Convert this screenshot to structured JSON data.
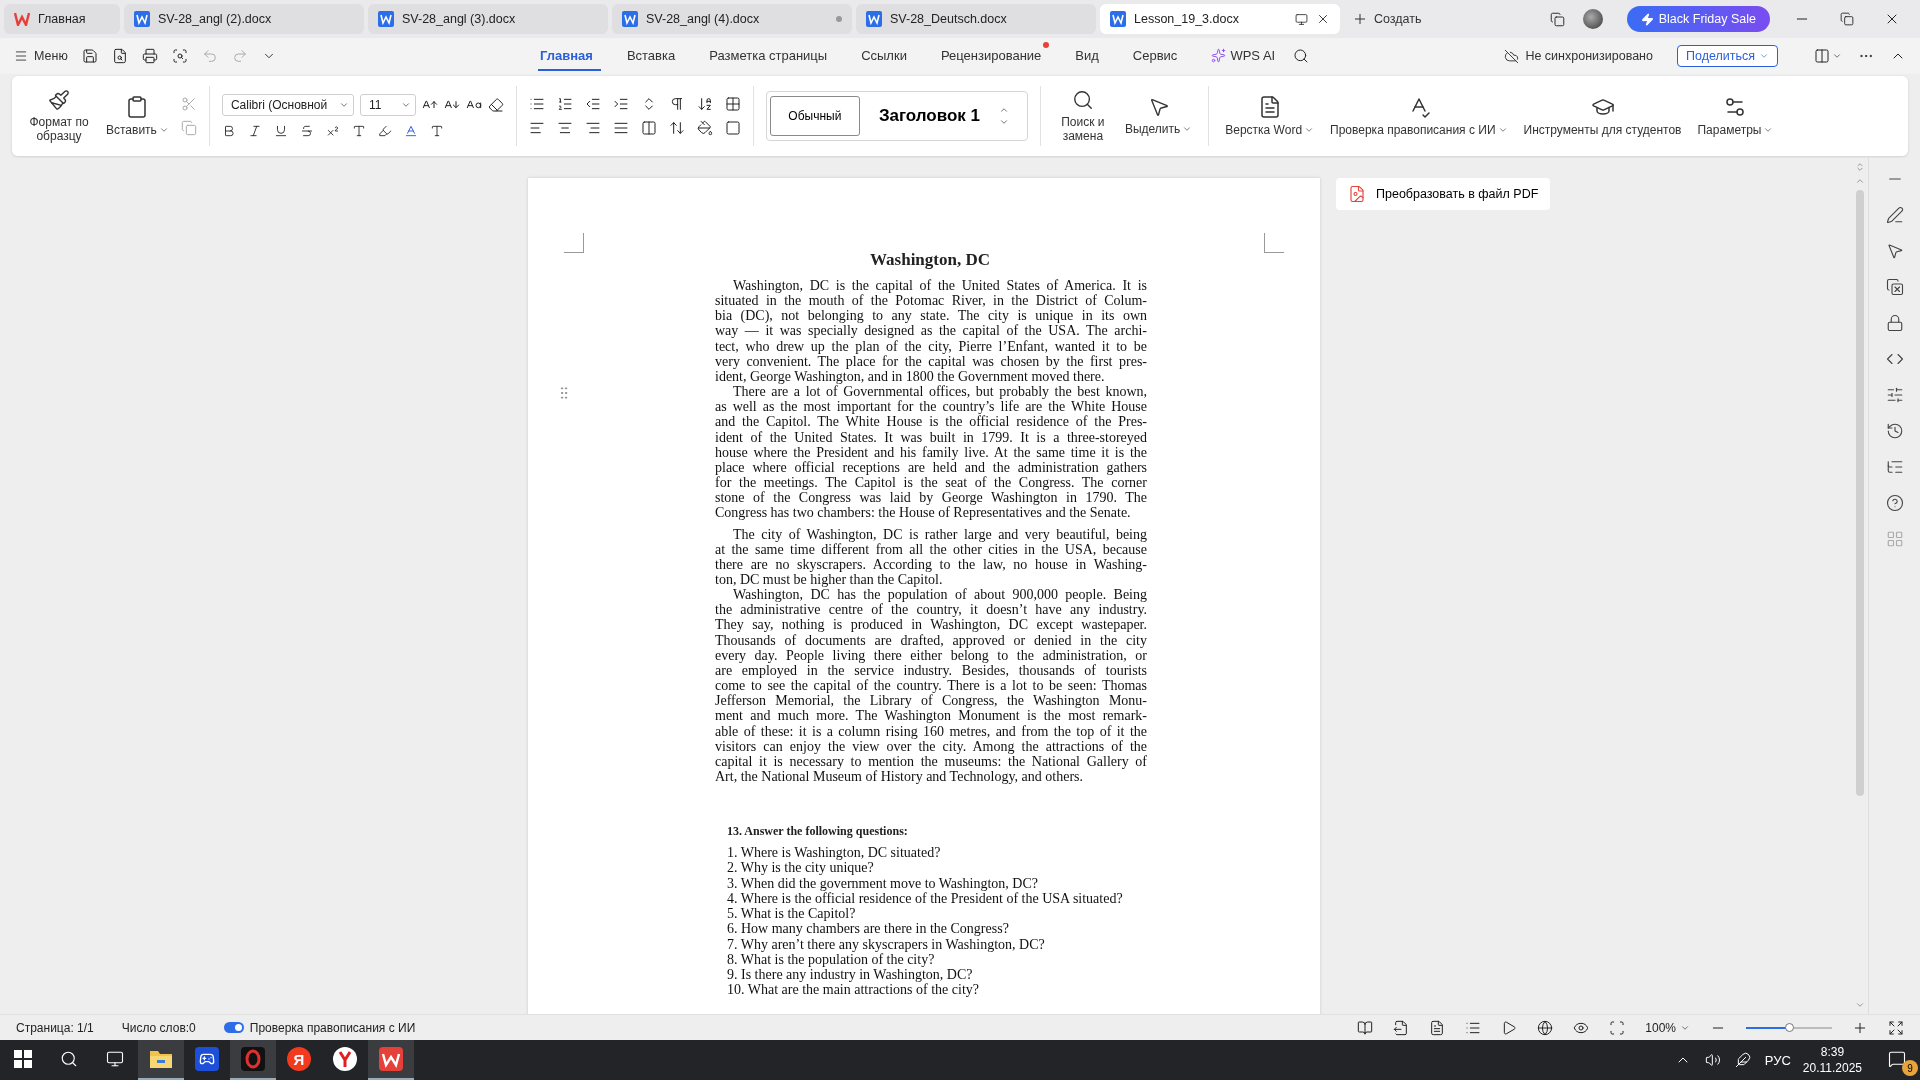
{
  "window_tabs": [
    {
      "kind": "home",
      "label": "Главная",
      "selected": false,
      "modified": false
    },
    {
      "kind": "doc",
      "label": "SV-28_angl (2).docx",
      "selected": false,
      "modified": false
    },
    {
      "kind": "doc",
      "label": "SV-28_angl (3).docx",
      "selected": false,
      "modified": false
    },
    {
      "kind": "doc",
      "label": "SV-28_angl (4).docx",
      "selected": false,
      "modified": true
    },
    {
      "kind": "doc",
      "label": "SV-28_Deutsch.docx",
      "selected": false,
      "modified": false
    },
    {
      "kind": "doc",
      "label": "Lesson_19_3.docx",
      "selected": true,
      "modified": false
    }
  ],
  "new_tab": "Создать",
  "promo_button": "Black Friday Sale",
  "menu_button": "Меню",
  "ribbon_tabs": [
    {
      "kind": "text",
      "label": "Главная",
      "selected": true,
      "notified": false
    },
    {
      "kind": "text",
      "label": "Вставка",
      "selected": false,
      "notified": false
    },
    {
      "kind": "text",
      "label": "Разметка страницы",
      "selected": false,
      "notified": false
    },
    {
      "kind": "text",
      "label": "Ссылки",
      "selected": false,
      "notified": false
    },
    {
      "kind": "text",
      "label": "Рецензирование",
      "selected": false,
      "notified": true
    },
    {
      "kind": "text",
      "label": "Вид",
      "selected": false,
      "notified": false
    },
    {
      "kind": "text",
      "label": "Сервис",
      "selected": false,
      "notified": false
    },
    {
      "kind": "ai",
      "label": "WPS AI",
      "selected": false,
      "notified": false
    }
  ],
  "sync_status": "Не синхронизировано",
  "share_button": "Поделиться",
  "ribbon": {
    "format_painter": "Формат по образцу",
    "paste": "Вставить",
    "font_name": "Calibri (Основной",
    "font_size": "11",
    "styles": [
      {
        "kind": "normal",
        "label": "Обычный",
        "selected": true
      },
      {
        "kind": "heading",
        "label": "Заголовок 1",
        "selected": false
      }
    ],
    "find_replace": "Поиск и замена",
    "select": "Выделить",
    "tools": [
      {
        "kind": "layout",
        "label": "Верстка Word",
        "dropdown": true
      },
      {
        "kind": "spell",
        "label": "Проверка правописания с ИИ",
        "dropdown": true
      },
      {
        "kind": "students",
        "label": "Инструменты для студентов",
        "dropdown": false
      },
      {
        "kind": "params",
        "label": "Параметры",
        "dropdown": true
      }
    ]
  },
  "side_panel": {
    "convert_button": "Преобразовать в файл PDF"
  },
  "document": {
    "title": "Washington, DC",
    "paragraphs": [
      {
        "lines": [
          "Washington, DC is the capital of the United States of America. It is",
          "situated in the mouth of the Potomac River, in the District of Colum-",
          "bia (DC), not belonging to any state. The city is unique in its own",
          "way — it was specially designed as the capital of the USA. The archi-",
          "tect, who drew up the plan of the city, Pierre l’Enfant, wanted it to be",
          "very convenient. The place for the capital was chosen by the first pres-",
          "ident, George Washington, and in 1800 the Government moved there."
        ]
      },
      {
        "lines": [
          "There are a lot of Governmental offices, but probably the best known,",
          "as well as the most important for the country’s life are the White House",
          "and the Capitol. The White House is the official residence of the Pres-",
          "ident of the United States. It was built in 1799. It is a three-storeyed",
          "house where the President and his family live. At the same time it is the",
          "place where official receptions are held and the administration gathers",
          "for the meetings. The Capitol is the seat of the Congress. The corner",
          "stone of the Congress was laid by George Washington in 1790. The",
          "Congress has two chambers: the House of Representatives and the Senate."
        ]
      },
      {
        "lines": [
          "The city of Washington, DC is rather large and very beautiful, being",
          "at the same time different from all the other cities in the USA, because",
          "there are no skyscrapers. According to the law, no house in Washing-",
          "ton, DC must be higher than the Capitol."
        ]
      },
      {
        "lines": [
          "Washington, DC has the population of about 900,000 people. Being",
          "the administrative centre of the country, it doesn’t have any industry.",
          "They say, nothing is produced in Washington, DC except wastepaper.",
          "Thousands of documents are drafted, approved or denied in the city",
          "every day. People living there either belong to the administration, or",
          "are employed in the service industry. Besides, thousands of tourists",
          "come to see the capital of the country. There is a lot to be seen: Thomas",
          "Jefferson Memorial, the Library of Congress, the Washington Monu-",
          "ment and much more. The Washington Monument is the most remark-",
          "able of these: it is a column rising 160 metres, and from the top of it the",
          "visitors can enjoy the view over the city. Among the attractions of the",
          "capital it is necessary to mention the museums: the National Gallery of",
          "Art, the National Museum of History and Technology, and others."
        ]
      }
    ],
    "exercise": {
      "heading": "13. Answer the following questions:",
      "questions": [
        "1. Where is Washington, DC situated?",
        "2. Why is the city unique?",
        "3. When did the government move to Washington, DC?",
        "4. Where is the official residence of the President of the USA situated?",
        "5. What is the Capitol?",
        "6. How many chambers are there in the Congress?",
        "7. Why aren’t there any skyscrapers in Washington, DC?",
        "8. What is the population of the city?",
        "9. Is there any industry in Washington, DC?",
        "10. What are the main attractions of the city?"
      ]
    }
  },
  "status_bar": {
    "page": "Страница: 1/1",
    "words": "Число слов:0",
    "spellcheck": {
      "label": "Проверка правописания с ИИ",
      "on": true
    },
    "zoom": "100%",
    "zoom_slider": {
      "level": 0.5
    }
  },
  "taskbar": {
    "apps": [
      {
        "kind": "folder",
        "active": true
      },
      {
        "kind": "game",
        "active": false
      },
      {
        "kind": "ring",
        "active": true
      },
      {
        "kind": "letter",
        "glyph": "Я",
        "active": false
      },
      {
        "kind": "browser",
        "active": false
      },
      {
        "kind": "office",
        "active": true
      }
    ],
    "language": "РУС",
    "time": "8:39",
    "date": "20.11.2025",
    "notifications": "9"
  }
}
